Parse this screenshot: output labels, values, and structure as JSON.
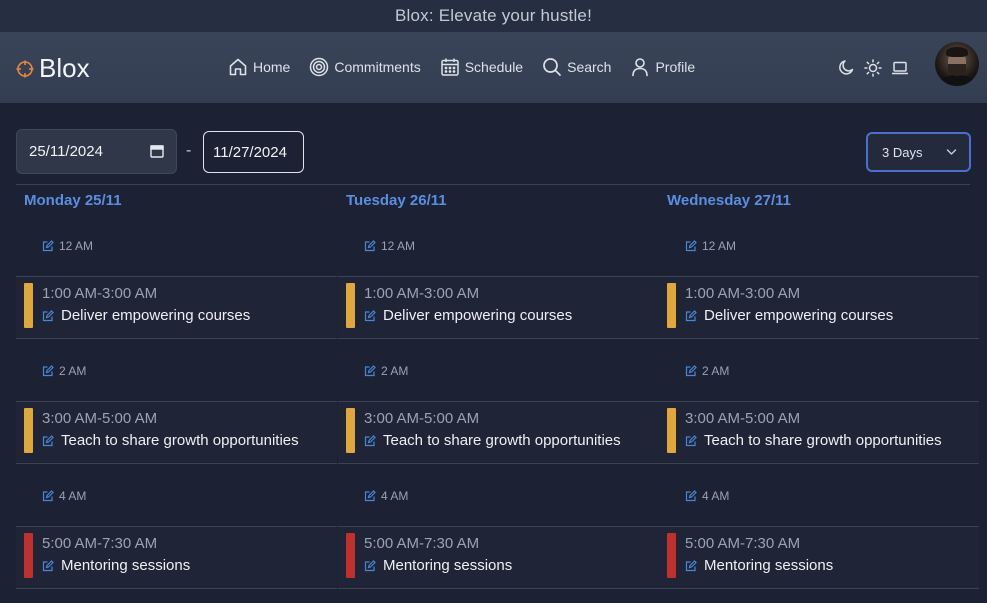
{
  "banner": {
    "text": "Blox: Elevate your hustle!"
  },
  "brand": {
    "name": "Blox",
    "icon": "crosshair-icon",
    "accent": "#e8863a"
  },
  "nav": {
    "home": "Home",
    "commitments": "Commitments",
    "schedule": "Schedule",
    "search": "Search",
    "profile": "Profile"
  },
  "theme_icons": [
    "moon-icon",
    "sun-icon",
    "laptop-icon"
  ],
  "date_range": {
    "start": "25/11/2024",
    "separator": "-",
    "end": "11/27/2024"
  },
  "view_select": {
    "selected": "3 Days"
  },
  "colors": {
    "accent_blue": "#5b8de0",
    "event_yellow": "#e0a83a",
    "event_red": "#c0312e"
  },
  "days": [
    {
      "title": "Monday 25/11",
      "slots": [
        "12 AM",
        "2 AM",
        "4 AM"
      ],
      "events": [
        {
          "time": "1:00 AM-3:00 AM",
          "title": "Deliver empowering courses",
          "color": "#e0a83a"
        },
        {
          "time": "3:00 AM-5:00 AM",
          "title": "Teach to share growth opportunities",
          "color": "#e0a83a"
        },
        {
          "time": "5:00 AM-7:30 AM",
          "title": "Mentoring sessions",
          "color": "#c0312e"
        }
      ]
    },
    {
      "title": "Tuesday 26/11",
      "slots": [
        "12 AM",
        "2 AM",
        "4 AM"
      ],
      "events": [
        {
          "time": "1:00 AM-3:00 AM",
          "title": "Deliver empowering courses",
          "color": "#e0a83a"
        },
        {
          "time": "3:00 AM-5:00 AM",
          "title": "Teach to share growth opportunities",
          "color": "#e0a83a"
        },
        {
          "time": "5:00 AM-7:30 AM",
          "title": "Mentoring sessions",
          "color": "#c0312e"
        }
      ]
    },
    {
      "title": "Wednesday 27/11",
      "slots": [
        "12 AM",
        "2 AM",
        "4 AM"
      ],
      "events": [
        {
          "time": "1:00 AM-3:00 AM",
          "title": "Deliver empowering courses",
          "color": "#e0a83a"
        },
        {
          "time": "3:00 AM-5:00 AM",
          "title": "Teach to share growth opportunities",
          "color": "#e0a83a"
        },
        {
          "time": "5:00 AM-7:30 AM",
          "title": "Mentoring sessions",
          "color": "#c0312e"
        }
      ]
    }
  ]
}
